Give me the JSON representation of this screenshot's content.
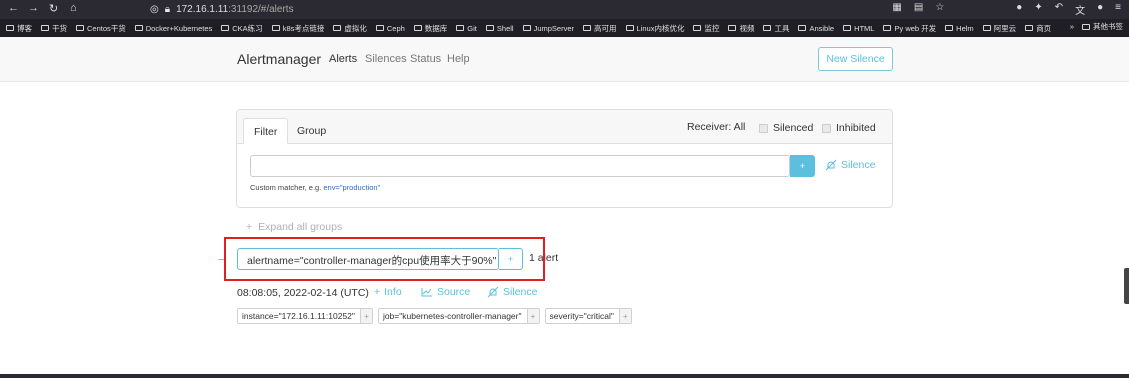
{
  "browser": {
    "url_host": "172.16.1.11",
    "url_rest": ":31192/#/alerts",
    "bookmarks": [
      "博客",
      "干货",
      "Centos干货",
      "Docker+Kubernetes",
      "CKA练习",
      "k8s考点链接",
      "虚拟化",
      "Ceph",
      "数据库",
      "Git",
      "Shell",
      "JumpServer",
      "高可用",
      "Linux内核优化",
      "监控",
      "视频",
      "工具",
      "Ansible",
      "HTML",
      "Py web 开发",
      "Helm",
      "阿里云",
      "商页"
    ],
    "other_bookmarks": "其他书签"
  },
  "nav": {
    "brand": "Alertmanager",
    "links": [
      "Alerts",
      "Silences",
      "Status",
      "Help"
    ],
    "new_silence": "New Silence"
  },
  "filter": {
    "tabs": [
      "Filter",
      "Group"
    ],
    "receiver": "Receiver: All",
    "silenced": "Silenced",
    "inhibited": "Inhibited",
    "input_value": "",
    "plus": "+",
    "silence_link": "Silence",
    "hint_prefix": "Custom matcher, e.g.",
    "hint_example": "env=\"production\""
  },
  "expand_all": "Expand all groups",
  "group": {
    "collapse": "−",
    "label": "alertname=\"controller-manager的cpu使用率大于90%\"",
    "plus": "+",
    "count": "1 alert"
  },
  "alert": {
    "time": "08:08:05, 2022-02-14 (UTC)",
    "info": "Info",
    "source": "Source",
    "silence": "Silence",
    "labels": [
      "instance=\"172.16.1.11:10252\"",
      "job=\"kubernetes-controller-manager\"",
      "severity=\"critical\""
    ]
  },
  "colors": {
    "accent": "#5bc0de",
    "highlight": "#e02020"
  }
}
